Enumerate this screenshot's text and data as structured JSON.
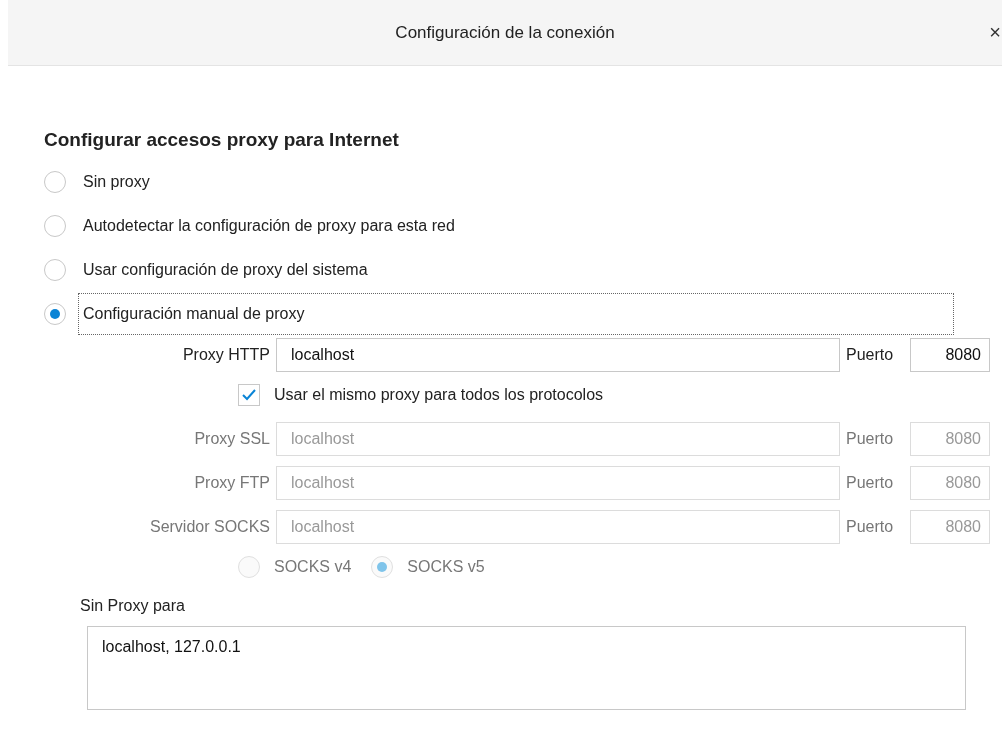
{
  "window": {
    "title": "Configuración de la conexión",
    "close": "×"
  },
  "heading": "Configurar accesos proxy para Internet",
  "proxy_modes": [
    {
      "label": "Sin proxy",
      "selected": false,
      "focused": false
    },
    {
      "label": "Autodetectar la configuración de proxy para esta red",
      "selected": false,
      "focused": false
    },
    {
      "label": "Usar configuración de proxy del sistema",
      "selected": false,
      "focused": false
    },
    {
      "label": "Configuración manual de proxy",
      "selected": true,
      "focused": true
    }
  ],
  "http": {
    "label": "Proxy HTTP",
    "value": "localhost",
    "port_label": "Puerto",
    "port": "8080",
    "disabled": false
  },
  "same_proxy": {
    "label": "Usar el mismo proxy para todos los protocolos",
    "checked": true
  },
  "other_proxies": [
    {
      "label": "Proxy SSL",
      "value": "localhost",
      "port_label": "Puerto",
      "port": "8080",
      "disabled": true
    },
    {
      "label": "Proxy FTP",
      "value": "localhost",
      "port_label": "Puerto",
      "port": "8080",
      "disabled": true
    },
    {
      "label": "Servidor SOCKS",
      "value": "localhost",
      "port_label": "Puerto",
      "port": "8080",
      "disabled": true
    }
  ],
  "socks_versions": [
    {
      "label": "SOCKS v4",
      "selected": false,
      "disabled": true
    },
    {
      "label": "SOCKS v5",
      "selected": true,
      "disabled": true
    }
  ],
  "no_proxy": {
    "label": "Sin Proxy para",
    "value": "localhost, 127.0.0.1"
  }
}
